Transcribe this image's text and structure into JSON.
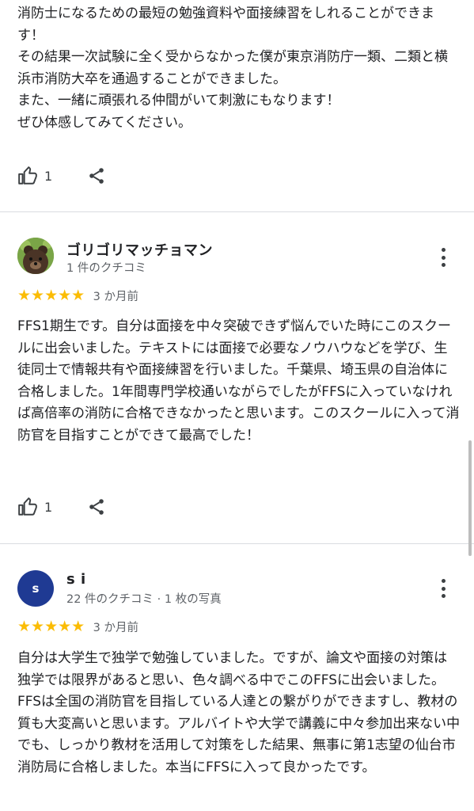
{
  "reviews": [
    {
      "text": "消防士になるための最短の勉強資料や面接練習をしれることができます！\nその結果一次試験に全く受からなかった僕が東京消防庁一類、二類と横浜市消防大卒を通過することができました。\nまた、一緒に頑張れる仲間がいて刺激にもなります！\nぜひ体感してみてください。",
      "likes": "1"
    },
    {
      "author": "ゴリゴリマッチョマン",
      "meta": "1 件のクチコミ",
      "rating": 5,
      "stars": "★★★★★",
      "time": "3 か月前",
      "text": "FFS1期生です。自分は面接を中々突破できず悩んでいた時にこのスクールに出会いました。テキストには面接で必要なノウハウなどを学び、生徒同士で情報共有や面接練習を行いました。千葉県、埼玉県の自治体に合格しました。1年間専門学校通いながらでしたがFFSに入っていなければ高倍率の消防に合格できなかったと思います。このスクールに入って消防官を目指すことができて最高でした！",
      "likes": "1"
    },
    {
      "author": "s i",
      "avatar_letter": "s",
      "meta": "22 件のクチコミ · 1 枚の写真",
      "rating": 5,
      "stars": "★★★★★",
      "time": "3 か月前",
      "text": "自分は大学生で独学で勉強していました。ですが、論文や面接の対策は独学では限界があると思い、色々調べる中でこのFFSに出会いました。FFSは全国の消防官を目指している人達との繋がりができますし、教材の質も大変高いと思います。アルバイトや大学で講義に中々参加出来ない中でも、しっかり教材を活用して対策をした結果、無事に第1志望の仙台市消防局に合格しました。本当にFFSに入って良かったです。"
    }
  ],
  "colors": {
    "star": "#fbbc04",
    "avatar_blue": "#1f3a93",
    "divider": "#dadce0"
  },
  "icons": [
    "thumb-up-icon",
    "share-icon",
    "more-vert-icon"
  ]
}
